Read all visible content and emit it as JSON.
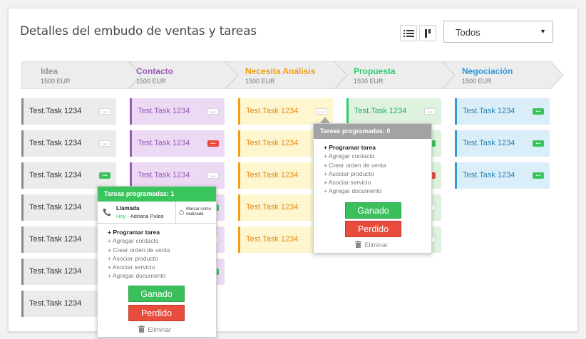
{
  "header": {
    "title": "Detalles del embudo de ventas y tareas"
  },
  "view_toggle": {
    "list_icon": "list-icon",
    "board_icon": "kanban-icon"
  },
  "filter": {
    "selected": "Todos"
  },
  "stages": [
    {
      "name": "Idea",
      "amount": "1500 EUR",
      "color": "#999999"
    },
    {
      "name": "Contacto",
      "amount": "1500 EUR",
      "color": "#9b59b6"
    },
    {
      "name": "Necesita Análisis",
      "amount": "1500 EUR",
      "color": "#f39c12"
    },
    {
      "name": "Propuesta",
      "amount": "1500 EUR",
      "color": "#2ecc71"
    },
    {
      "name": "Negociación",
      "amount": "1500 EUR",
      "color": "#3498db"
    }
  ],
  "task_label": "Test.Task 1234",
  "popup_left": {
    "header": "Tareas programadas: 1",
    "task": {
      "type": "Llamada",
      "when": "Hoy",
      "separator": " - ",
      "who": "Adriana Puleo",
      "mark_done": "Marcar como realizada"
    },
    "actions": [
      "+ Programar tarea",
      "+ Agregar contacto",
      "+ Crear orden de venta",
      "+ Asociar producto",
      "+ Asociar servicio",
      "+ Agregar documento"
    ],
    "won": "Ganado",
    "lost": "Perdido",
    "delete": "Eliminar"
  },
  "popup_right": {
    "header": "Tareas programadas: 0",
    "actions": [
      "+ Programar tarea",
      "+ Agregar contacto",
      "+ Crear orden de venta",
      "+ Asociar producto",
      "+ Asociar servicio",
      "+ Agregar documento"
    ],
    "won": "Ganado",
    "lost": "Perdido",
    "delete": "Eliminar"
  },
  "colors": {
    "green": "#3ac45e",
    "red": "#e74c3c"
  }
}
